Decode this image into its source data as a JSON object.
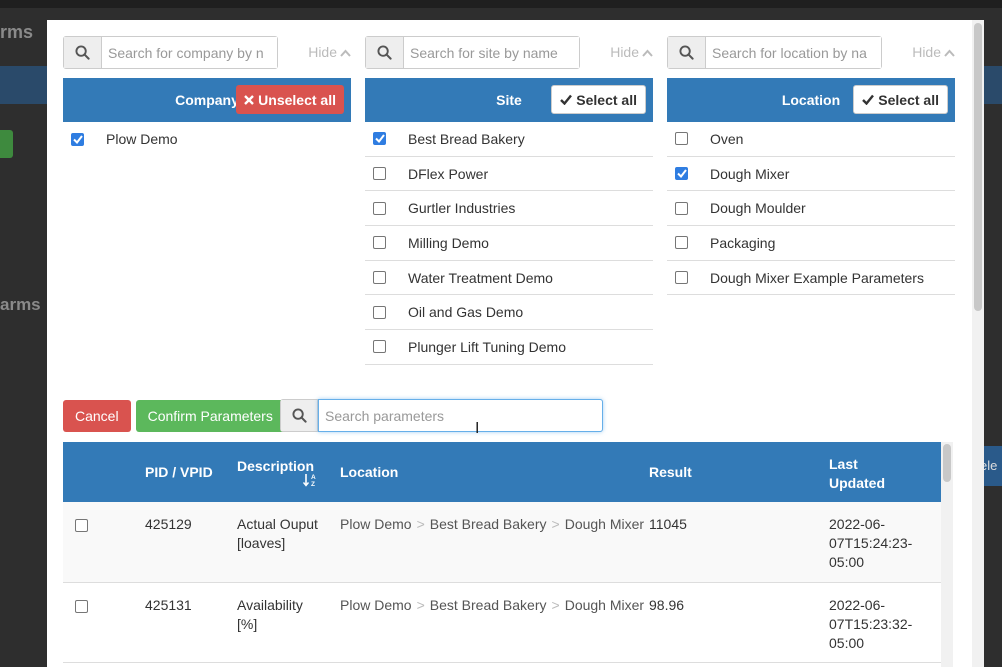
{
  "background": {
    "title": "rms",
    "section_title": "arms",
    "right_label": "ele"
  },
  "columns": [
    {
      "key": "company",
      "search_placeholder": "Search for company by n",
      "hide_label": "Hide",
      "header": "Company",
      "action_label": "Unselect all",
      "action_icon": "times-icon",
      "action_style": "danger",
      "items": [
        {
          "label": "Plow Demo",
          "checked": true
        }
      ]
    },
    {
      "key": "site",
      "search_placeholder": "Search for site by name",
      "hide_label": "Hide",
      "header": "Site",
      "action_label": "Select all",
      "action_icon": "check-icon",
      "action_style": "default",
      "items": [
        {
          "label": "Best Bread Bakery",
          "checked": true
        },
        {
          "label": "DFlex Power",
          "checked": false
        },
        {
          "label": "Gurtler Industries",
          "checked": false
        },
        {
          "label": "Milling Demo",
          "checked": false
        },
        {
          "label": "Water Treatment Demo",
          "checked": false
        },
        {
          "label": "Oil and Gas Demo",
          "checked": false
        },
        {
          "label": "Plunger Lift Tuning Demo",
          "checked": false
        }
      ]
    },
    {
      "key": "location",
      "search_placeholder": "Search for location by na",
      "hide_label": "Hide",
      "header": "Location",
      "action_label": "Select all",
      "action_icon": "check-icon",
      "action_style": "default",
      "items": [
        {
          "label": "Oven",
          "checked": false
        },
        {
          "label": "Dough Mixer",
          "checked": true
        },
        {
          "label": "Dough Moulder",
          "checked": false
        },
        {
          "label": "Packaging",
          "checked": false
        },
        {
          "label": "Dough Mixer Example Parameters",
          "checked": false
        }
      ]
    }
  ],
  "actions": {
    "cancel": "Cancel",
    "confirm": "Confirm Parameters"
  },
  "param_search": {
    "placeholder": "Search parameters",
    "value": ""
  },
  "table": {
    "headers": {
      "pid": "PID / VPID",
      "description": "Description",
      "location": "Location",
      "result": "Result",
      "last_updated_1": "Last",
      "last_updated_2": "Updated"
    },
    "rows": [
      {
        "checked": false,
        "pid": "425129",
        "description_1": "Actual Ouput",
        "description_2": "[loaves]",
        "location": [
          "Plow Demo",
          "Best Bread Bakery",
          "Dough Mixer"
        ],
        "result": "11045",
        "updated_1": "2022-06-",
        "updated_2": "07T15:24:23-",
        "updated_3": "05:00"
      },
      {
        "checked": false,
        "pid": "425131",
        "description_1": "Availability",
        "description_2": "[%]",
        "location": [
          "Plow Demo",
          "Best Bread Bakery",
          "Dough Mixer"
        ],
        "result": "98.96",
        "updated_1": "2022-06-",
        "updated_2": "07T15:23:32-",
        "updated_3": "05:00"
      }
    ]
  },
  "colors": {
    "header_blue": "#337ab7",
    "danger": "#d9534f",
    "success": "#5cb85c",
    "checkbox_on": "#2f7de1"
  }
}
